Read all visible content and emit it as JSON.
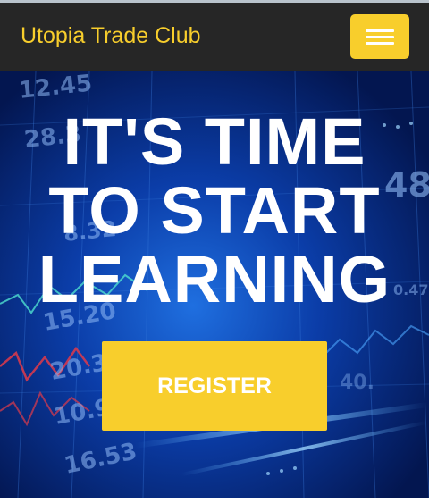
{
  "navbar": {
    "brand": "Utopia Trade Club",
    "menu_icon": "hamburger-menu-icon"
  },
  "hero": {
    "headline_lines": [
      "IT'S TIME",
      "TO START",
      "LEARNING"
    ],
    "register_label": "REGISTER",
    "background_numbers": [
      "12.45",
      "28.3",
      "8.32",
      "15.20",
      "20.3",
      "10.9",
      "16.53",
      "48",
      "40.",
      "0.47"
    ]
  },
  "colors": {
    "accent": "#f8ce2c",
    "navbar_bg": "#262626",
    "hero_bg": "#041a5c"
  }
}
